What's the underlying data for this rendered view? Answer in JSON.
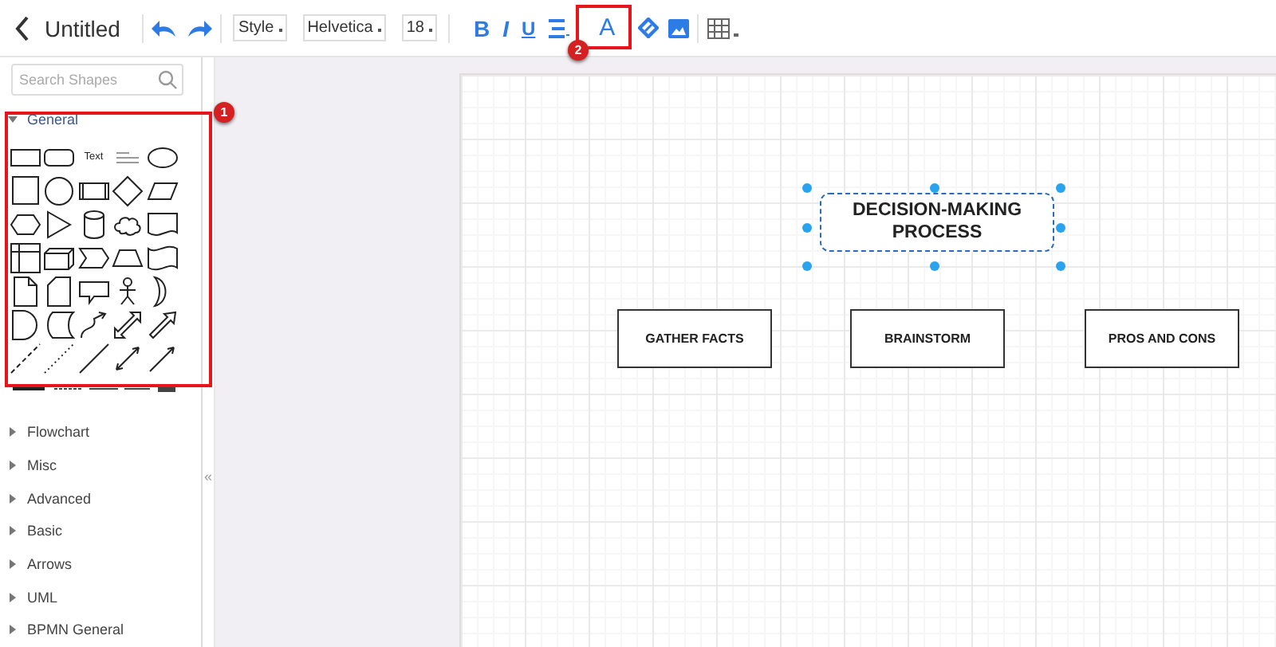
{
  "toolbar": {
    "title": "Untitled",
    "style_select": "Style",
    "font_select": "Helvetica",
    "size_select": "18",
    "format_buttons": [
      "B",
      "I",
      "U"
    ],
    "font_color_button": "A"
  },
  "sidebar": {
    "search": {
      "placeholder": "Search Shapes"
    },
    "palette_text": "Text",
    "categories": [
      {
        "label": "General",
        "expanded": true
      },
      {
        "label": "Flowchart",
        "expanded": false
      },
      {
        "label": "Misc",
        "expanded": false
      },
      {
        "label": "Advanced",
        "expanded": false
      },
      {
        "label": "Basic",
        "expanded": false
      },
      {
        "label": "Arrows",
        "expanded": false
      },
      {
        "label": "UML",
        "expanded": false
      },
      {
        "label": "BPMN General",
        "expanded": false
      }
    ],
    "collapse_toggle": "«"
  },
  "canvas": {
    "shapes": [
      {
        "kind": "title",
        "text": "DECISION-MAKING PROCESS",
        "selected": true
      },
      {
        "kind": "box",
        "text": "GATHER FACTS",
        "selected": false
      },
      {
        "kind": "box",
        "text": "BRAINSTORM",
        "selected": false
      },
      {
        "kind": "box",
        "text": "PROS AND CONS",
        "selected": false
      }
    ]
  },
  "annotations": [
    {
      "label": "1"
    },
    {
      "label": "2"
    }
  ]
}
